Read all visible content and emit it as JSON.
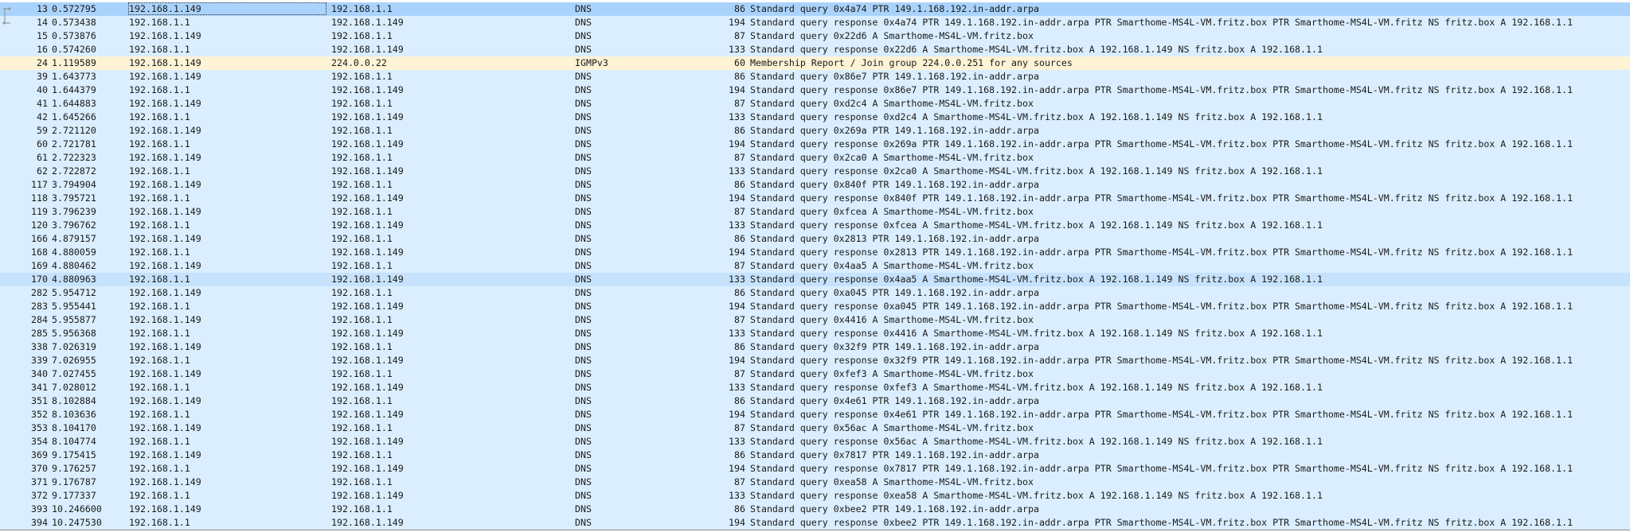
{
  "packets": [
    {
      "no": "13",
      "time": "0.572795",
      "src": "192.168.1.149",
      "dst": "192.168.1.1",
      "proto": "DNS",
      "len": "86",
      "info": "Standard query 0x4a74 PTR 149.1.168.192.in-addr.arpa",
      "state": "selected"
    },
    {
      "no": "14",
      "time": "0.573438",
      "src": "192.168.1.1",
      "dst": "192.168.1.149",
      "proto": "DNS",
      "len": "194",
      "info": "Standard query response 0x4a74 PTR 149.1.168.192.in-addr.arpa PTR Smarthome-MS4L-VM.fritz.box PTR Smarthome-MS4L-VM.fritz NS fritz.box A 192.168.1.1"
    },
    {
      "no": "15",
      "time": "0.573876",
      "src": "192.168.1.149",
      "dst": "192.168.1.1",
      "proto": "DNS",
      "len": "87",
      "info": "Standard query 0x22d6 A Smarthome-MS4L-VM.fritz.box"
    },
    {
      "no": "16",
      "time": "0.574260",
      "src": "192.168.1.1",
      "dst": "192.168.1.149",
      "proto": "DNS",
      "len": "133",
      "info": "Standard query response 0x22d6 A Smarthome-MS4L-VM.fritz.box A 192.168.1.149 NS fritz.box A 192.168.1.1"
    },
    {
      "no": "24",
      "time": "1.119589",
      "src": "192.168.1.149",
      "dst": "224.0.0.22",
      "proto": "IGMPv3",
      "len": "60",
      "info": "Membership Report / Join group 224.0.0.251 for any sources"
    },
    {
      "no": "39",
      "time": "1.643773",
      "src": "192.168.1.149",
      "dst": "192.168.1.1",
      "proto": "DNS",
      "len": "86",
      "info": "Standard query 0x86e7 PTR 149.1.168.192.in-addr.arpa"
    },
    {
      "no": "40",
      "time": "1.644379",
      "src": "192.168.1.1",
      "dst": "192.168.1.149",
      "proto": "DNS",
      "len": "194",
      "info": "Standard query response 0x86e7 PTR 149.1.168.192.in-addr.arpa PTR Smarthome-MS4L-VM.fritz.box PTR Smarthome-MS4L-VM.fritz NS fritz.box A 192.168.1.1"
    },
    {
      "no": "41",
      "time": "1.644883",
      "src": "192.168.1.149",
      "dst": "192.168.1.1",
      "proto": "DNS",
      "len": "87",
      "info": "Standard query 0xd2c4 A Smarthome-MS4L-VM.fritz.box"
    },
    {
      "no": "42",
      "time": "1.645266",
      "src": "192.168.1.1",
      "dst": "192.168.1.149",
      "proto": "DNS",
      "len": "133",
      "info": "Standard query response 0xd2c4 A Smarthome-MS4L-VM.fritz.box A 192.168.1.149 NS fritz.box A 192.168.1.1"
    },
    {
      "no": "59",
      "time": "2.721120",
      "src": "192.168.1.149",
      "dst": "192.168.1.1",
      "proto": "DNS",
      "len": "86",
      "info": "Standard query 0x269a PTR 149.1.168.192.in-addr.arpa"
    },
    {
      "no": "60",
      "time": "2.721781",
      "src": "192.168.1.1",
      "dst": "192.168.1.149",
      "proto": "DNS",
      "len": "194",
      "info": "Standard query response 0x269a PTR 149.1.168.192.in-addr.arpa PTR Smarthome-MS4L-VM.fritz.box PTR Smarthome-MS4L-VM.fritz NS fritz.box A 192.168.1.1"
    },
    {
      "no": "61",
      "time": "2.722323",
      "src": "192.168.1.149",
      "dst": "192.168.1.1",
      "proto": "DNS",
      "len": "87",
      "info": "Standard query 0x2ca0 A Smarthome-MS4L-VM.fritz.box"
    },
    {
      "no": "62",
      "time": "2.722872",
      "src": "192.168.1.1",
      "dst": "192.168.1.149",
      "proto": "DNS",
      "len": "133",
      "info": "Standard query response 0x2ca0 A Smarthome-MS4L-VM.fritz.box A 192.168.1.149 NS fritz.box A 192.168.1.1"
    },
    {
      "no": "117",
      "time": "3.794904",
      "src": "192.168.1.149",
      "dst": "192.168.1.1",
      "proto": "DNS",
      "len": "86",
      "info": "Standard query 0x840f PTR 149.1.168.192.in-addr.arpa"
    },
    {
      "no": "118",
      "time": "3.795721",
      "src": "192.168.1.1",
      "dst": "192.168.1.149",
      "proto": "DNS",
      "len": "194",
      "info": "Standard query response 0x840f PTR 149.1.168.192.in-addr.arpa PTR Smarthome-MS4L-VM.fritz.box PTR Smarthome-MS4L-VM.fritz NS fritz.box A 192.168.1.1"
    },
    {
      "no": "119",
      "time": "3.796239",
      "src": "192.168.1.149",
      "dst": "192.168.1.1",
      "proto": "DNS",
      "len": "87",
      "info": "Standard query 0xfcea A Smarthome-MS4L-VM.fritz.box"
    },
    {
      "no": "120",
      "time": "3.796762",
      "src": "192.168.1.1",
      "dst": "192.168.1.149",
      "proto": "DNS",
      "len": "133",
      "info": "Standard query response 0xfcea A Smarthome-MS4L-VM.fritz.box A 192.168.1.149 NS fritz.box A 192.168.1.1"
    },
    {
      "no": "166",
      "time": "4.879157",
      "src": "192.168.1.149",
      "dst": "192.168.1.1",
      "proto": "DNS",
      "len": "86",
      "info": "Standard query 0x2813 PTR 149.1.168.192.in-addr.arpa"
    },
    {
      "no": "168",
      "time": "4.880059",
      "src": "192.168.1.1",
      "dst": "192.168.1.149",
      "proto": "DNS",
      "len": "194",
      "info": "Standard query response 0x2813 PTR 149.1.168.192.in-addr.arpa PTR Smarthome-MS4L-VM.fritz.box PTR Smarthome-MS4L-VM.fritz NS fritz.box A 192.168.1.1"
    },
    {
      "no": "169",
      "time": "4.880462",
      "src": "192.168.1.149",
      "dst": "192.168.1.1",
      "proto": "DNS",
      "len": "87",
      "info": "Standard query 0x4aa5 A Smarthome-MS4L-VM.fritz.box"
    },
    {
      "no": "170",
      "time": "4.880963",
      "src": "192.168.1.1",
      "dst": "192.168.1.149",
      "proto": "DNS",
      "len": "133",
      "info": "Standard query response 0x4aa5 A Smarthome-MS4L-VM.fritz.box A 192.168.1.149 NS fritz.box A 192.168.1.1",
      "state": "hover"
    },
    {
      "no": "282",
      "time": "5.954712",
      "src": "192.168.1.149",
      "dst": "192.168.1.1",
      "proto": "DNS",
      "len": "86",
      "info": "Standard query 0xa045 PTR 149.1.168.192.in-addr.arpa"
    },
    {
      "no": "283",
      "time": "5.955441",
      "src": "192.168.1.1",
      "dst": "192.168.1.149",
      "proto": "DNS",
      "len": "194",
      "info": "Standard query response 0xa045 PTR 149.1.168.192.in-addr.arpa PTR Smarthome-MS4L-VM.fritz.box PTR Smarthome-MS4L-VM.fritz NS fritz.box A 192.168.1.1"
    },
    {
      "no": "284",
      "time": "5.955877",
      "src": "192.168.1.149",
      "dst": "192.168.1.1",
      "proto": "DNS",
      "len": "87",
      "info": "Standard query 0x4416 A Smarthome-MS4L-VM.fritz.box"
    },
    {
      "no": "285",
      "time": "5.956368",
      "src": "192.168.1.1",
      "dst": "192.168.1.149",
      "proto": "DNS",
      "len": "133",
      "info": "Standard query response 0x4416 A Smarthome-MS4L-VM.fritz.box A 192.168.1.149 NS fritz.box A 192.168.1.1"
    },
    {
      "no": "338",
      "time": "7.026319",
      "src": "192.168.1.149",
      "dst": "192.168.1.1",
      "proto": "DNS",
      "len": "86",
      "info": "Standard query 0x32f9 PTR 149.1.168.192.in-addr.arpa"
    },
    {
      "no": "339",
      "time": "7.026955",
      "src": "192.168.1.1",
      "dst": "192.168.1.149",
      "proto": "DNS",
      "len": "194",
      "info": "Standard query response 0x32f9 PTR 149.1.168.192.in-addr.arpa PTR Smarthome-MS4L-VM.fritz.box PTR Smarthome-MS4L-VM.fritz NS fritz.box A 192.168.1.1"
    },
    {
      "no": "340",
      "time": "7.027455",
      "src": "192.168.1.149",
      "dst": "192.168.1.1",
      "proto": "DNS",
      "len": "87",
      "info": "Standard query 0xfef3 A Smarthome-MS4L-VM.fritz.box"
    },
    {
      "no": "341",
      "time": "7.028012",
      "src": "192.168.1.1",
      "dst": "192.168.1.149",
      "proto": "DNS",
      "len": "133",
      "info": "Standard query response 0xfef3 A Smarthome-MS4L-VM.fritz.box A 192.168.1.149 NS fritz.box A 192.168.1.1"
    },
    {
      "no": "351",
      "time": "8.102884",
      "src": "192.168.1.149",
      "dst": "192.168.1.1",
      "proto": "DNS",
      "len": "86",
      "info": "Standard query 0x4e61 PTR 149.1.168.192.in-addr.arpa"
    },
    {
      "no": "352",
      "time": "8.103636",
      "src": "192.168.1.1",
      "dst": "192.168.1.149",
      "proto": "DNS",
      "len": "194",
      "info": "Standard query response 0x4e61 PTR 149.1.168.192.in-addr.arpa PTR Smarthome-MS4L-VM.fritz.box PTR Smarthome-MS4L-VM.fritz NS fritz.box A 192.168.1.1"
    },
    {
      "no": "353",
      "time": "8.104170",
      "src": "192.168.1.149",
      "dst": "192.168.1.1",
      "proto": "DNS",
      "len": "87",
      "info": "Standard query 0x56ac A Smarthome-MS4L-VM.fritz.box"
    },
    {
      "no": "354",
      "time": "8.104774",
      "src": "192.168.1.1",
      "dst": "192.168.1.149",
      "proto": "DNS",
      "len": "133",
      "info": "Standard query response 0x56ac A Smarthome-MS4L-VM.fritz.box A 192.168.1.149 NS fritz.box A 192.168.1.1"
    },
    {
      "no": "369",
      "time": "9.175415",
      "src": "192.168.1.149",
      "dst": "192.168.1.1",
      "proto": "DNS",
      "len": "86",
      "info": "Standard query 0x7817 PTR 149.1.168.192.in-addr.arpa"
    },
    {
      "no": "370",
      "time": "9.176257",
      "src": "192.168.1.1",
      "dst": "192.168.1.149",
      "proto": "DNS",
      "len": "194",
      "info": "Standard query response 0x7817 PTR 149.1.168.192.in-addr.arpa PTR Smarthome-MS4L-VM.fritz.box PTR Smarthome-MS4L-VM.fritz NS fritz.box A 192.168.1.1"
    },
    {
      "no": "371",
      "time": "9.176787",
      "src": "192.168.1.149",
      "dst": "192.168.1.1",
      "proto": "DNS",
      "len": "87",
      "info": "Standard query 0xea58 A Smarthome-MS4L-VM.fritz.box"
    },
    {
      "no": "372",
      "time": "9.177337",
      "src": "192.168.1.1",
      "dst": "192.168.1.149",
      "proto": "DNS",
      "len": "133",
      "info": "Standard query response 0xea58 A Smarthome-MS4L-VM.fritz.box A 192.168.1.149 NS fritz.box A 192.168.1.1"
    },
    {
      "no": "393",
      "time": "10.246600",
      "src": "192.168.1.149",
      "dst": "192.168.1.1",
      "proto": "DNS",
      "len": "86",
      "info": "Standard query 0xbee2 PTR 149.1.168.192.in-addr.arpa"
    },
    {
      "no": "394",
      "time": "10.247530",
      "src": "192.168.1.1",
      "dst": "192.168.1.149",
      "proto": "DNS",
      "len": "194",
      "info": "Standard query response 0xbee2 PTR 149.1.168.192.in-addr.arpa PTR Smarthome-MS4L-VM.fritz.box PTR Smarthome-MS4L-VM.fritz NS fritz.box A 192.168.1.1"
    }
  ],
  "colors": {
    "row_dns": "#daeeff",
    "row_igmp": "#fff3d6",
    "row_selected": "#aad3fc",
    "row_hover": "#c6e2fc"
  }
}
